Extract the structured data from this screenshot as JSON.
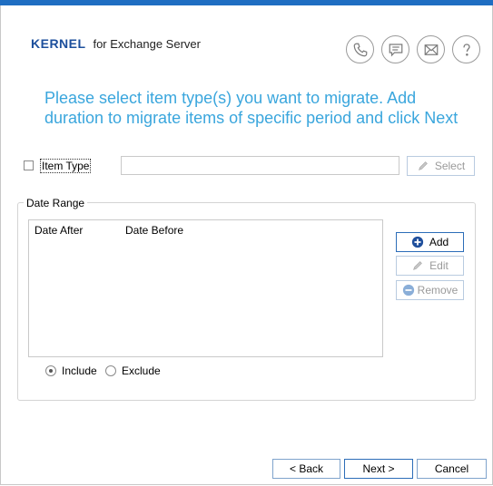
{
  "header": {
    "brand": "KERNEL",
    "product": "for Exchange Server",
    "tools": [
      {
        "name": "phone-icon",
        "title": "Call"
      },
      {
        "name": "chat-icon",
        "title": "Chat"
      },
      {
        "name": "mail-icon",
        "title": "Email"
      },
      {
        "name": "help-icon",
        "title": "Help"
      }
    ]
  },
  "instruction": "Please select item type(s) you want to migrate. Add duration to migrate items of specific period and click Next",
  "item_type": {
    "label": "Item Type",
    "checked": false,
    "value": "",
    "select_label": "Select"
  },
  "date_range": {
    "title": "Date Range",
    "columns": [
      "Date After",
      "Date Before"
    ],
    "rows": [],
    "add_label": "Add",
    "edit_label": "Edit",
    "remove_label": "Remove",
    "include_label": "Include",
    "exclude_label": "Exclude",
    "selected": "Include"
  },
  "footer": {
    "back_label": "< Back",
    "next_label": "Next >",
    "cancel_label": "Cancel"
  },
  "colors": {
    "accent": "#3aa6dd",
    "brand": "#1c4f9c",
    "topbar": "#1f6ec2"
  }
}
